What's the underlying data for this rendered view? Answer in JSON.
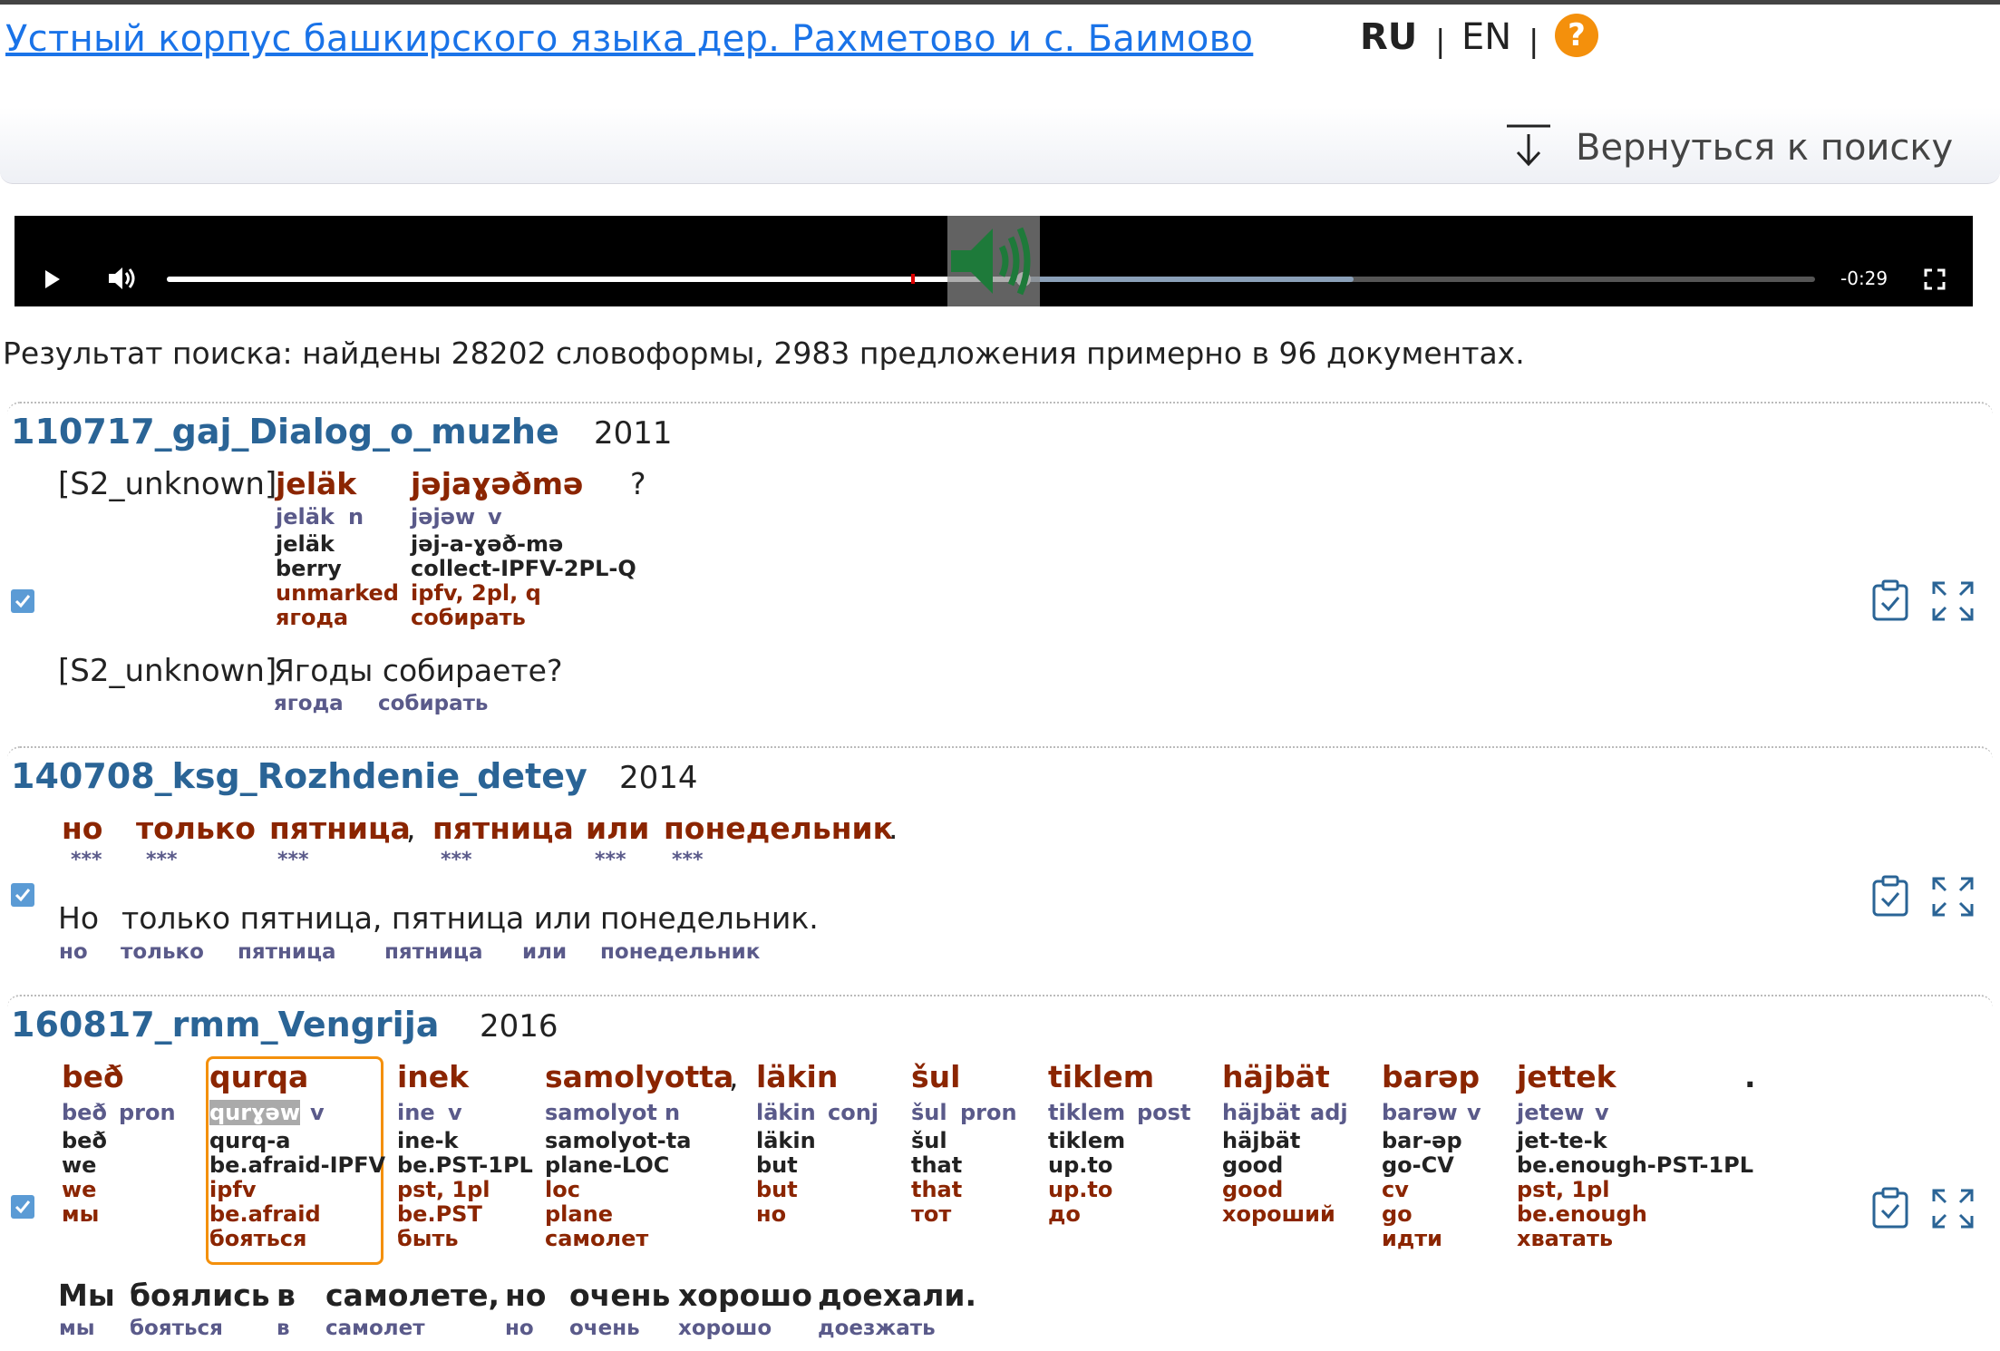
{
  "header": {
    "site_title": "Устный корпус башкирского языка дер. Рахметово и с. Баимово",
    "lang_ru": "RU",
    "lang_separator": "|",
    "lang_en": "EN",
    "help_symbol": "?",
    "back_label": "Вернуться к поиску",
    "back_icon": "download-arrow-icon"
  },
  "player": {
    "time_remaining": "-0:29",
    "progress_fraction": 0.52,
    "buffered_fraction": 0.72,
    "icons": [
      "play-icon",
      "volume-icon",
      "fullscreen-icon",
      "speaker-icon"
    ]
  },
  "results": {
    "summary": "Результат поиска: найдены 28202 словоформы, 2983 предложения примерно в 96 документах."
  },
  "documents": [
    {
      "title": "110717_gaj_Dialog_o_muzhe",
      "year": "2011",
      "speaker": "[S2_unknown]",
      "words": [
        {
          "form": "jeläk",
          "lemma": "jeläk",
          "pos": "n",
          "morph": "jeläk",
          "gloss": "berry",
          "tags": "unmarked",
          "ru": "ягода"
        },
        {
          "form": "jəjaɣəðmə",
          "lemma": "jəjəw",
          "pos": "v",
          "morph": "jəj-a-ɣəð-mə",
          "gloss": "collect-IPFV-2PL-Q",
          "tags": "ipfv, 2pl, q",
          "ru": "собирать"
        }
      ],
      "punct": "?",
      "translation_speaker": "[S2_unknown]",
      "translation": "Ягоды собираете?",
      "translation_lemmas": [
        "ягода",
        "собирать"
      ]
    },
    {
      "title": "140708_ksg_Rozhdenie_detey",
      "year": "2014",
      "words": [
        {
          "form": "но",
          "stars": "***"
        },
        {
          "form": "только",
          "stars": "***"
        },
        {
          "form": "пятница",
          "stars": "***"
        },
        {
          "form": "пятница",
          "stars": "***"
        },
        {
          "form": "или",
          "stars": "***"
        },
        {
          "form": "понедельник",
          "stars": "***"
        }
      ],
      "comma": ",",
      "period": ".",
      "translation_words": [
        "Но",
        "только пятница, пятница или",
        "понедельник."
      ],
      "translation_lemmas": [
        "но",
        "только",
        "пятница",
        "пятница",
        "или",
        "понедельник"
      ]
    },
    {
      "title": "160817_rmm_Vengrija",
      "year": "2016",
      "words": [
        {
          "form": "beð",
          "lemma": "beð",
          "pos": "pron",
          "morph": "beð",
          "gloss": "we",
          "tags": "we",
          "ru": "мы"
        },
        {
          "form": "qurqa",
          "lemma": "qurɣəw",
          "pos": "v",
          "morph": "qurq-a",
          "gloss": "be.afraid-IPFV",
          "tags": "ipfv",
          "ru2": "be.afraid",
          "ru": "бояться"
        },
        {
          "form": "inek",
          "lemma": "ine",
          "pos": "v",
          "morph": "ine-k",
          "gloss": "be.PST-1PL",
          "tags": "pst, 1pl",
          "ru2": "be.PST",
          "ru": "быть"
        },
        {
          "form": "samolyotta",
          "lemma": "samolyot",
          "pos": "n",
          "morph": "samolyot-ta",
          "gloss": "plane-LOC",
          "tags": "loc",
          "ru2": "plane",
          "ru": "самолет"
        },
        {
          "form": "läkin",
          "lemma": "läkin",
          "pos": "conj",
          "morph": "läkin",
          "gloss": "but",
          "tags": "but",
          "ru": "но"
        },
        {
          "form": "šul",
          "lemma": "šul",
          "pos": "pron",
          "morph": "šul",
          "gloss": "that",
          "tags": "that",
          "ru": "тот"
        },
        {
          "form": "tiklem",
          "lemma": "tiklem",
          "pos": "post",
          "morph": "tiklem",
          "gloss": "up.to",
          "tags": "up.to",
          "ru": "до"
        },
        {
          "form": "häjbät",
          "lemma": "häjbät",
          "pos": "adj",
          "morph": "häjbät",
          "gloss": "good",
          "tags": "good",
          "ru": "хороший"
        },
        {
          "form": "barəp",
          "lemma": "barəw",
          "pos": "v",
          "morph": "bar-əp",
          "gloss": "go-CV",
          "tags": "cv",
          "ru2": "go",
          "ru": "идти"
        },
        {
          "form": "jettek",
          "lemma": "jetew",
          "pos": "v",
          "morph": "jet-te-k",
          "gloss": "be.enough-PST-1PL",
          "tags": "pst, 1pl",
          "ru2": "be.enough",
          "ru": "хватать"
        }
      ],
      "comma": ",",
      "period": ".",
      "translation_words": [
        "Мы",
        "боялись",
        "в",
        "самолете,",
        "но",
        "очень",
        "хорошо",
        "доехали."
      ],
      "translation_lemmas": [
        "мы",
        "бояться",
        "в",
        "самолет",
        "но",
        "очень",
        "хорошо",
        "доезжать"
      ]
    }
  ],
  "icons": {
    "checkbox": "checkbox-checked-icon",
    "copy": "clipboard-check-icon",
    "expand": "expand-icon"
  },
  "colors": {
    "link": "#1a73e8",
    "doc_title": "#2a6496",
    "word": "#8b2500",
    "lemma": "#5a5a8a",
    "help": "#f4900c",
    "checkbox": "#5b9bd5",
    "highlight": "#f4900c"
  }
}
